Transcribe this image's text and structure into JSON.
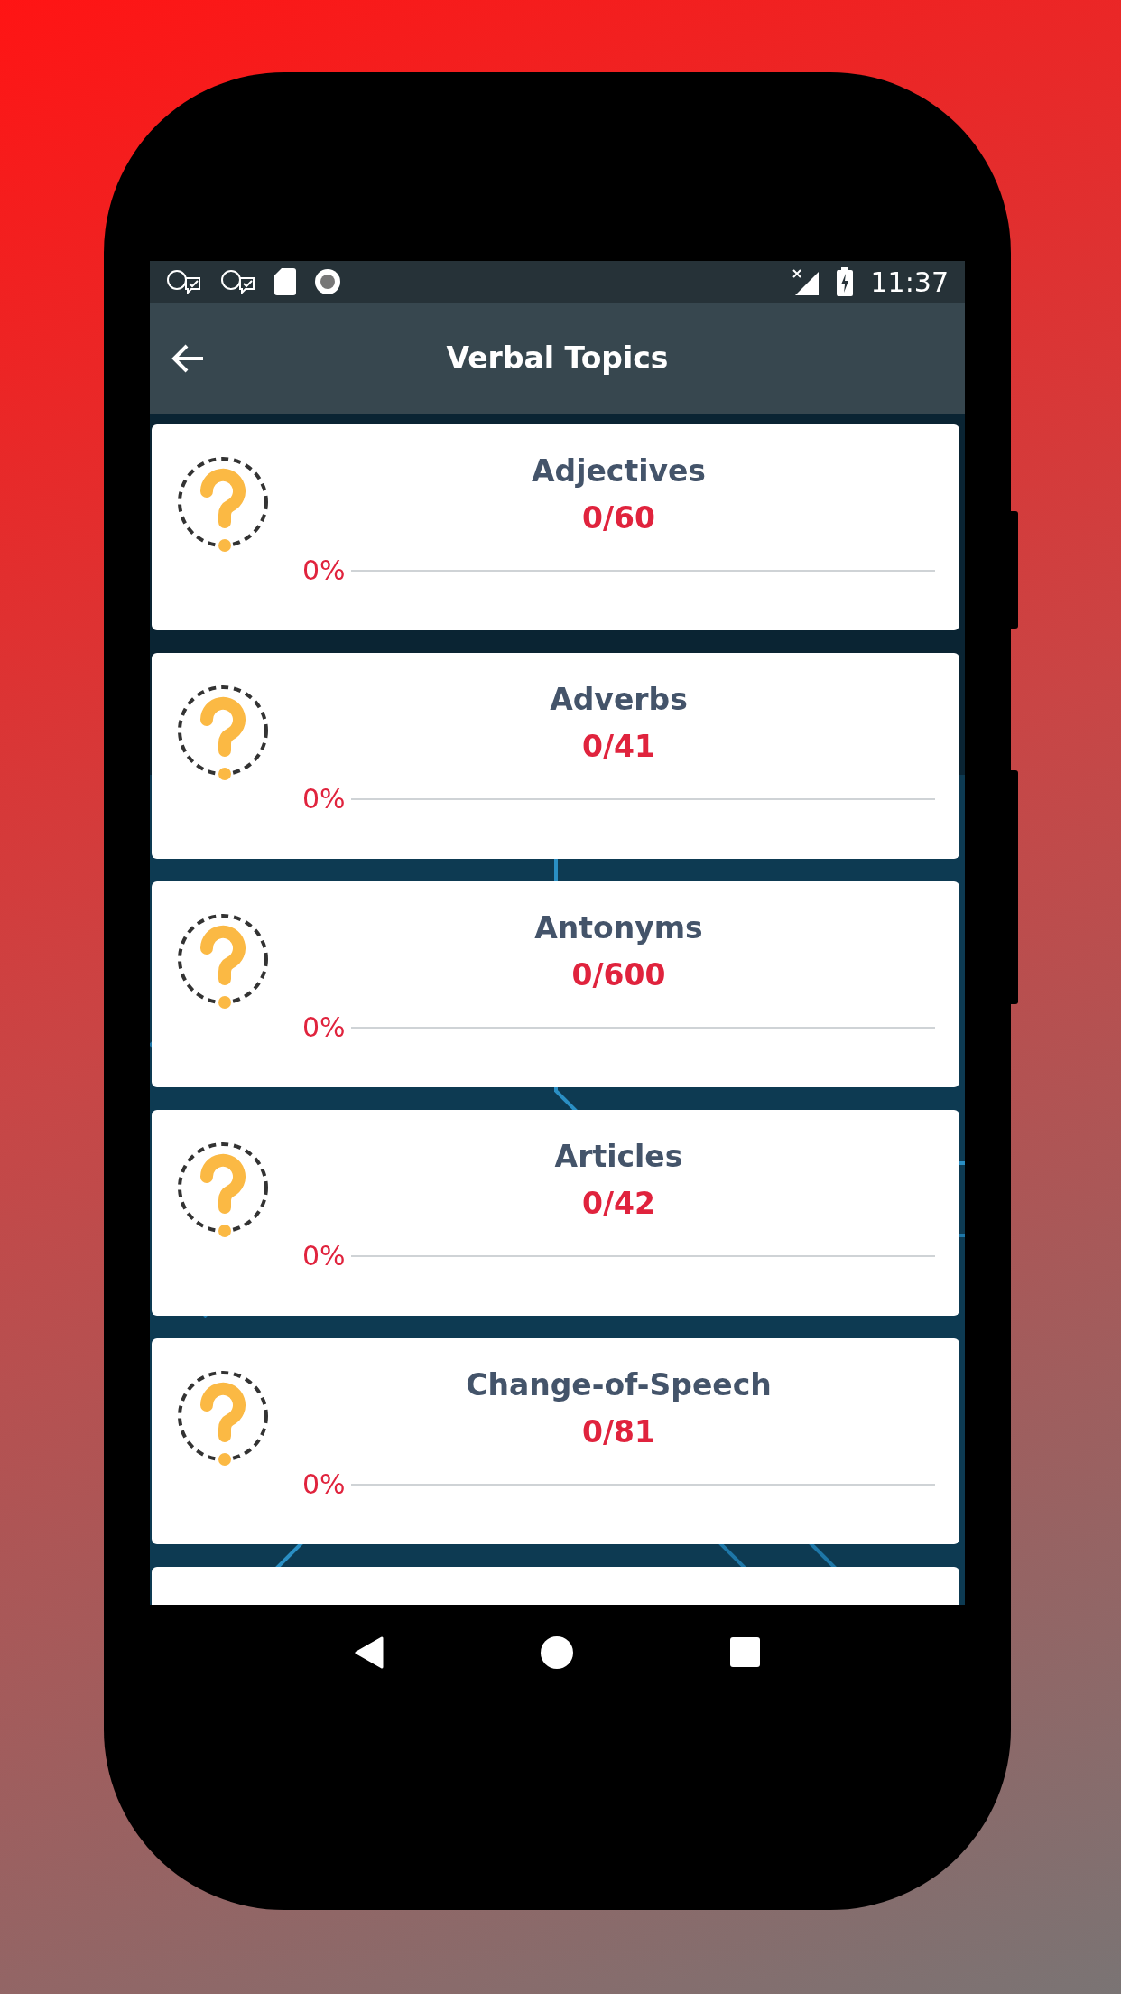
{
  "status_bar": {
    "time": "11:37"
  },
  "toolbar": {
    "title": "Verbal Topics"
  },
  "topics": [
    {
      "title": "Adjectives",
      "count": "0/60",
      "percent": "0%"
    },
    {
      "title": "Adverbs",
      "count": "0/41",
      "percent": "0%"
    },
    {
      "title": "Antonyms",
      "count": "0/600",
      "percent": "0%"
    },
    {
      "title": "Articles",
      "count": "0/42",
      "percent": "0%"
    },
    {
      "title": "Change-of-Speech",
      "count": "0/81",
      "percent": "0%"
    }
  ]
}
